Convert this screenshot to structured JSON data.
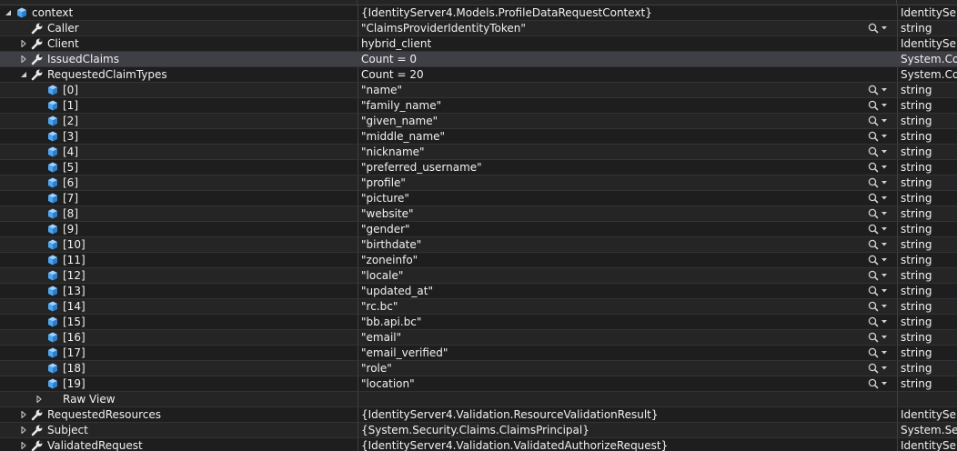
{
  "colors": {
    "background": "#252526",
    "row_dark": "#1e1e1e",
    "row_selected": "#3f3f46",
    "text": "#f1f1f1",
    "grid_line": "#3f3f46",
    "object_icon_blue": "#4ea6f0",
    "wrench_icon": "#e8e8e8"
  },
  "rows": [
    {
      "level": 0,
      "expander": "expanded",
      "icon": "object-cube-icon",
      "name": "context",
      "value": "{IdentityServer4.Models.ProfileDataRequestContext}",
      "type": "IdentityServ",
      "viz": false,
      "shade": "dark"
    },
    {
      "level": 1,
      "expander": "none",
      "icon": "wrench-icon",
      "name": "Caller",
      "value": "\"ClaimsProviderIdentityToken\"",
      "type": "string",
      "viz": true,
      "shade": "light"
    },
    {
      "level": 1,
      "expander": "collapsed",
      "icon": "wrench-icon",
      "name": "Client",
      "value": "hybrid_client",
      "type": "IdentityServ",
      "viz": false,
      "shade": "dark"
    },
    {
      "level": 1,
      "expander": "collapsed",
      "icon": "wrench-icon",
      "name": "IssuedClaims",
      "value": "Count = 0",
      "type": "System.Coll",
      "viz": false,
      "shade": "selected"
    },
    {
      "level": 1,
      "expander": "expanded",
      "icon": "wrench-icon",
      "name": "RequestedClaimTypes",
      "value": "Count = 20",
      "type": "System.Coll",
      "viz": false,
      "shade": "dark"
    },
    {
      "level": 2,
      "expander": "none",
      "icon": "object-cube-icon",
      "name": "[0]",
      "value": "\"name\"",
      "type": "string",
      "viz": true,
      "shade": "light"
    },
    {
      "level": 2,
      "expander": "none",
      "icon": "object-cube-icon",
      "name": "[1]",
      "value": "\"family_name\"",
      "type": "string",
      "viz": true,
      "shade": "dark"
    },
    {
      "level": 2,
      "expander": "none",
      "icon": "object-cube-icon",
      "name": "[2]",
      "value": "\"given_name\"",
      "type": "string",
      "viz": true,
      "shade": "light"
    },
    {
      "level": 2,
      "expander": "none",
      "icon": "object-cube-icon",
      "name": "[3]",
      "value": "\"middle_name\"",
      "type": "string",
      "viz": true,
      "shade": "dark"
    },
    {
      "level": 2,
      "expander": "none",
      "icon": "object-cube-icon",
      "name": "[4]",
      "value": "\"nickname\"",
      "type": "string",
      "viz": true,
      "shade": "light"
    },
    {
      "level": 2,
      "expander": "none",
      "icon": "object-cube-icon",
      "name": "[5]",
      "value": "\"preferred_username\"",
      "type": "string",
      "viz": true,
      "shade": "dark"
    },
    {
      "level": 2,
      "expander": "none",
      "icon": "object-cube-icon",
      "name": "[6]",
      "value": "\"profile\"",
      "type": "string",
      "viz": true,
      "shade": "light"
    },
    {
      "level": 2,
      "expander": "none",
      "icon": "object-cube-icon",
      "name": "[7]",
      "value": "\"picture\"",
      "type": "string",
      "viz": true,
      "shade": "dark"
    },
    {
      "level": 2,
      "expander": "none",
      "icon": "object-cube-icon",
      "name": "[8]",
      "value": "\"website\"",
      "type": "string",
      "viz": true,
      "shade": "light"
    },
    {
      "level": 2,
      "expander": "none",
      "icon": "object-cube-icon",
      "name": "[9]",
      "value": "\"gender\"",
      "type": "string",
      "viz": true,
      "shade": "dark"
    },
    {
      "level": 2,
      "expander": "none",
      "icon": "object-cube-icon",
      "name": "[10]",
      "value": "\"birthdate\"",
      "type": "string",
      "viz": true,
      "shade": "light"
    },
    {
      "level": 2,
      "expander": "none",
      "icon": "object-cube-icon",
      "name": "[11]",
      "value": "\"zoneinfo\"",
      "type": "string",
      "viz": true,
      "shade": "dark"
    },
    {
      "level": 2,
      "expander": "none",
      "icon": "object-cube-icon",
      "name": "[12]",
      "value": "\"locale\"",
      "type": "string",
      "viz": true,
      "shade": "light"
    },
    {
      "level": 2,
      "expander": "none",
      "icon": "object-cube-icon",
      "name": "[13]",
      "value": "\"updated_at\"",
      "type": "string",
      "viz": true,
      "shade": "dark"
    },
    {
      "level": 2,
      "expander": "none",
      "icon": "object-cube-icon",
      "name": "[14]",
      "value": "\"rc.bc\"",
      "type": "string",
      "viz": true,
      "shade": "light"
    },
    {
      "level": 2,
      "expander": "none",
      "icon": "object-cube-icon",
      "name": "[15]",
      "value": "\"bb.api.bc\"",
      "type": "string",
      "viz": true,
      "shade": "dark"
    },
    {
      "level": 2,
      "expander": "none",
      "icon": "object-cube-icon",
      "name": "[16]",
      "value": "\"email\"",
      "type": "string",
      "viz": true,
      "shade": "light"
    },
    {
      "level": 2,
      "expander": "none",
      "icon": "object-cube-icon",
      "name": "[17]",
      "value": "\"email_verified\"",
      "type": "string",
      "viz": true,
      "shade": "dark"
    },
    {
      "level": 2,
      "expander": "none",
      "icon": "object-cube-icon",
      "name": "[18]",
      "value": "\"role\"",
      "type": "string",
      "viz": true,
      "shade": "light"
    },
    {
      "level": 2,
      "expander": "none",
      "icon": "object-cube-icon",
      "name": "[19]",
      "value": "\"location\"",
      "type": "string",
      "viz": true,
      "shade": "dark"
    },
    {
      "level": 2,
      "expander": "collapsed",
      "icon": "raw-view-icon",
      "name": "Raw View",
      "value": "",
      "type": "",
      "viz": false,
      "shade": "light"
    },
    {
      "level": 1,
      "expander": "collapsed",
      "icon": "wrench-icon",
      "name": "RequestedResources",
      "value": "{IdentityServer4.Validation.ResourceValidationResult}",
      "type": "IdentityServ",
      "viz": false,
      "shade": "dark"
    },
    {
      "level": 1,
      "expander": "collapsed",
      "icon": "wrench-icon",
      "name": "Subject",
      "value": "{System.Security.Claims.ClaimsPrincipal}",
      "type": "System.Secu",
      "viz": false,
      "shade": "light"
    },
    {
      "level": 1,
      "expander": "collapsed",
      "icon": "wrench-icon",
      "name": "ValidatedRequest",
      "value": "{IdentityServer4.Validation.ValidatedAuthorizeRequest}",
      "type": "IdentityServ",
      "viz": false,
      "shade": "dark"
    }
  ]
}
